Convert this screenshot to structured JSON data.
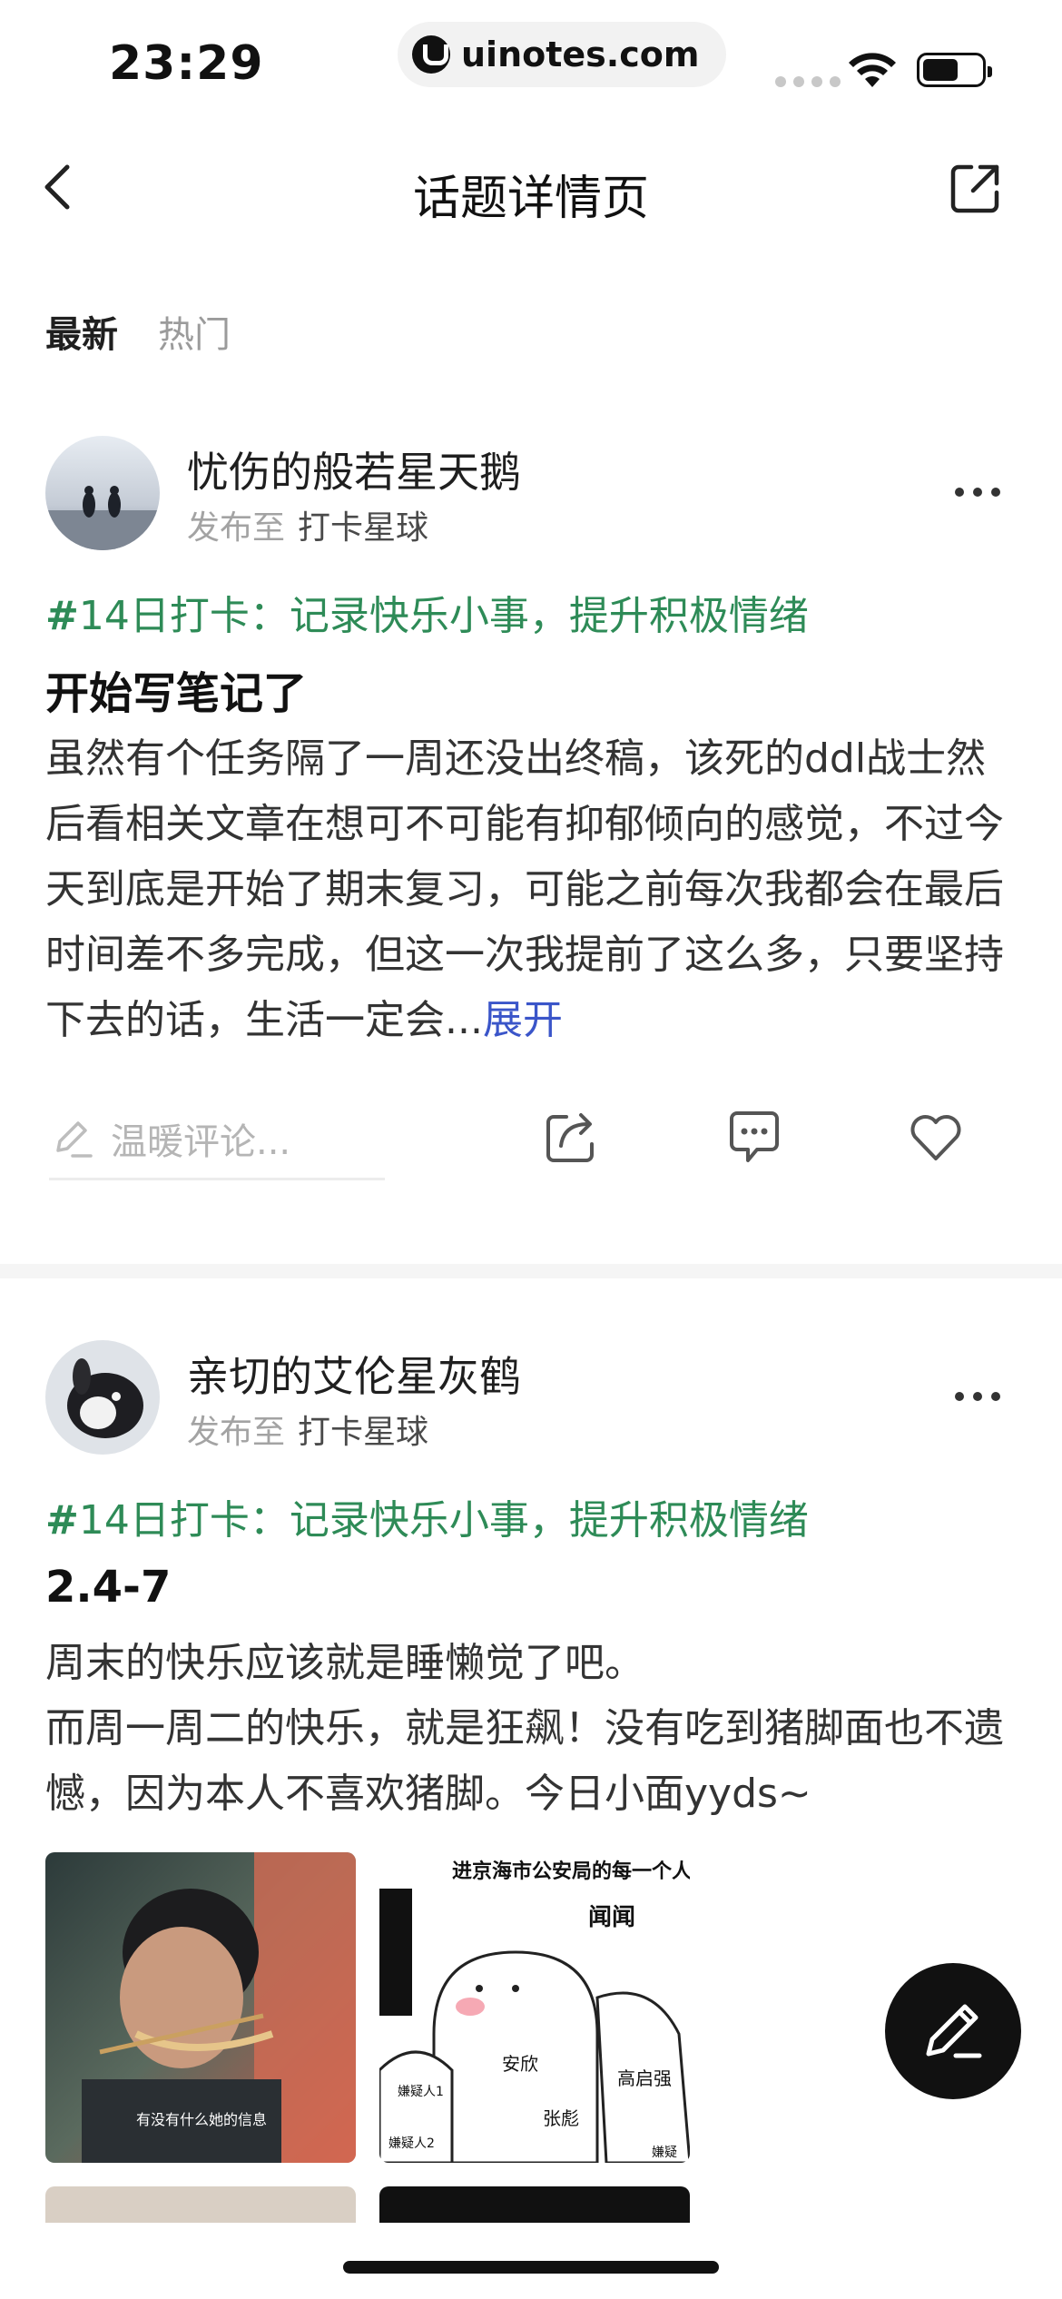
{
  "status_bar": {
    "time": "23:29",
    "url": "uinotes.com"
  },
  "nav": {
    "title": "话题详情页",
    "back_icon": "chevron-left-icon",
    "share_icon": "external-share-icon"
  },
  "tabs": [
    {
      "label": "最新",
      "active": true
    },
    {
      "label": "热门",
      "active": false
    }
  ],
  "posts": [
    {
      "author": "忧伤的般若星天鹅",
      "meta_prefix": "发布至",
      "planet": "打卡星球",
      "topic_hash": "#",
      "topic": "14日打卡：记录快乐小事，提升积极情绪",
      "title": "开始写笔记了",
      "body": "虽然有个任务隔了一周还没出终稿，该死的ddl战士然后看相关文章在想可不可能有抑郁倾向的感觉，不过今天到底是开始了期末复习，可能之前每次我都会在最后时间差不多完成，但这一次我提前了这么多，只要坚持下去的话，生活一定会...",
      "expand_label": "展开",
      "comment_placeholder": "温暖评论..."
    },
    {
      "author": "亲切的艾伦星灰鹤",
      "meta_prefix": "发布至",
      "planet": "打卡星球",
      "topic_hash": "#",
      "topic": "14日打卡：记录快乐小事，提升积极情绪",
      "title": "2.4-7",
      "body_line1": "周末的快乐应该就是睡懒觉了吧。",
      "body_line2": "而周一周二的快乐，就是狂飙！没有吃到猪脚面也不遗憾，因为本人不喜欢猪脚。今日小面yyds~",
      "image1_caption": "有没有什么她的信息",
      "image2_heading": "进京海市公安局的每一个人：",
      "image2_sound": "闻闻",
      "image2_labels": [
        "安欣",
        "高启强",
        "张彪",
        "嫌疑人1",
        "嫌疑人2",
        "嫌疑"
      ]
    }
  ],
  "colors": {
    "topic_green": "#2e8b57",
    "expand_blue": "#3a55c9",
    "fab_bg": "#111111"
  }
}
